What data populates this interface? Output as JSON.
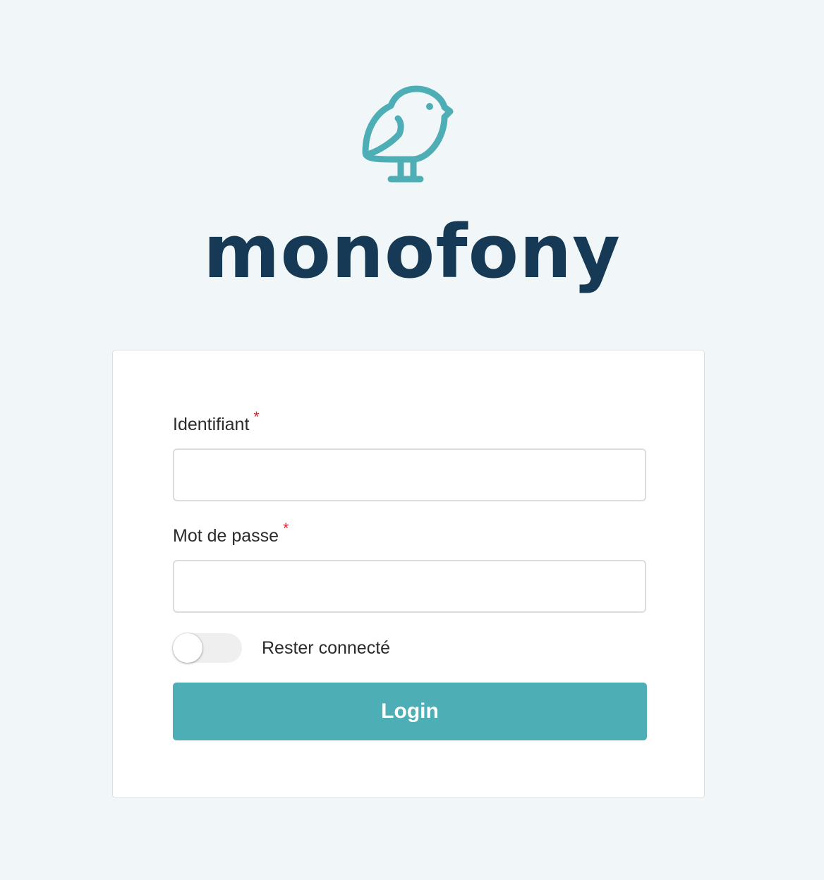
{
  "brand": {
    "name": "monofony",
    "logo_icon": "bird-icon",
    "logo_color": "#4eaeb5",
    "wordmark_color": "#163a55"
  },
  "login_form": {
    "username": {
      "label": "Identifiant",
      "required_marker": "*",
      "value": ""
    },
    "password": {
      "label": "Mot de passe",
      "required_marker": "*",
      "value": ""
    },
    "remember_me": {
      "label": "Rester connecté",
      "checked": false
    },
    "submit_label": "Login",
    "submit_color": "#4eaeb5"
  },
  "colors": {
    "background": "#f1f7f8",
    "required": "#d9262f"
  }
}
